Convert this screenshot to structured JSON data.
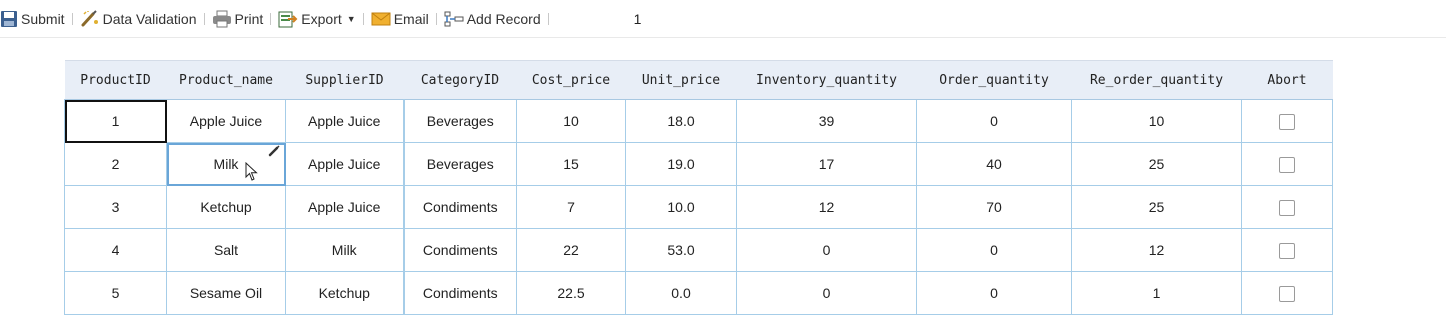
{
  "toolbar": {
    "submit": "Submit",
    "validation": "Data Validation",
    "print": "Print",
    "export": "Export",
    "email": "Email",
    "add_record": "Add Record",
    "page": "1"
  },
  "table": {
    "headers": [
      "ProductID",
      "Product_name",
      "SupplierID",
      "CategoryID",
      "Cost_price",
      "Unit_price",
      "Inventory_quantity",
      "Order_quantity",
      "Re_order_quantity",
      "Abort"
    ],
    "rows": [
      [
        "1",
        "Apple Juice",
        "Apple Juice",
        "Beverages",
        "10",
        "18.0",
        "39",
        "0",
        "10"
      ],
      [
        "2",
        "Milk",
        "Apple Juice",
        "Beverages",
        "15",
        "19.0",
        "17",
        "40",
        "25"
      ],
      [
        "3",
        "Ketchup",
        "Apple Juice",
        "Condiments",
        "7",
        "10.0",
        "12",
        "70",
        "25"
      ],
      [
        "4",
        "Salt",
        "Milk",
        "Condiments",
        "22",
        "53.0",
        "0",
        "0",
        "12"
      ],
      [
        "5",
        "Sesame Oil",
        "Ketchup",
        "Condiments",
        "22.5",
        "0.0",
        "0",
        "0",
        "1"
      ]
    ]
  },
  "colors": {
    "header_bg": "#e8eef7",
    "grid_line": "#a6cde8",
    "selection": "#111111",
    "edit_border": "#6aa6d8"
  },
  "icons": [
    "save-icon",
    "data-validation-icon",
    "print-icon",
    "export-icon",
    "email-icon",
    "add-record-icon",
    "pencil-icon",
    "mouse-cursor-icon"
  ]
}
